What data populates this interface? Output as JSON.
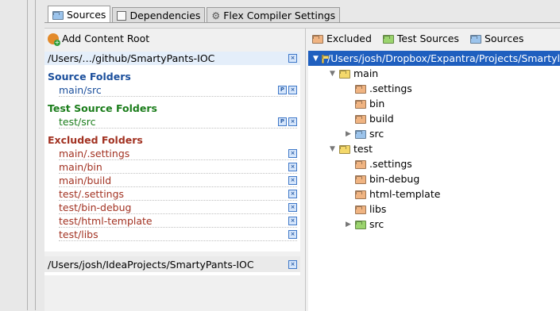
{
  "tabs": [
    {
      "label": "Sources",
      "icon": "sources-icon",
      "active": true
    },
    {
      "label": "Dependencies",
      "icon": "dependencies-icon",
      "active": false
    },
    {
      "label": "Flex Compiler Settings",
      "icon": "flex-compiler-icon",
      "active": false
    }
  ],
  "left": {
    "add_root": "Add Content Root",
    "root1": {
      "path": "/Users/…/github/SmartyPants-IOC",
      "source_title": "Source Folders",
      "source_folders": [
        "main/src"
      ],
      "test_title": "Test Source Folders",
      "test_folders": [
        "test/src"
      ],
      "excluded_title": "Excluded Folders",
      "excluded_folders": [
        "main/.settings",
        "main/bin",
        "main/build",
        "test/.settings",
        "test/bin-debug",
        "test/html-template",
        "test/libs"
      ]
    },
    "root2": {
      "path": "/Users/josh/IdeaProjects/SmartyPants-IOC"
    }
  },
  "right": {
    "mark_excluded": "Excluded",
    "mark_test": "Test Sources",
    "mark_sources": "Sources",
    "tree": [
      {
        "label": "/Users/josh/Dropbox/Expantra/Projects/Smartyl",
        "level": 0,
        "arrow": "▼",
        "color": "yellow",
        "selected": true
      },
      {
        "label": "main",
        "level": 1,
        "arrow": "▼",
        "color": "yellow"
      },
      {
        "label": ".settings",
        "level": 2,
        "arrow": "",
        "color": "orange"
      },
      {
        "label": "bin",
        "level": 2,
        "arrow": "",
        "color": "orange"
      },
      {
        "label": "build",
        "level": 2,
        "arrow": "",
        "color": "orange"
      },
      {
        "label": "src",
        "level": 2,
        "arrow": "▶",
        "color": "blue"
      },
      {
        "label": "test",
        "level": 1,
        "arrow": "▼",
        "color": "yellow"
      },
      {
        "label": ".settings",
        "level": 2,
        "arrow": "",
        "color": "orange"
      },
      {
        "label": "bin-debug",
        "level": 2,
        "arrow": "",
        "color": "orange"
      },
      {
        "label": "html-template",
        "level": 2,
        "arrow": "",
        "color": "orange"
      },
      {
        "label": "libs",
        "level": 2,
        "arrow": "",
        "color": "orange"
      },
      {
        "label": "src",
        "level": 2,
        "arrow": "▶",
        "color": "green"
      }
    ]
  },
  "colors": {
    "selection": "#1f5fbf",
    "source": "#1b4f9c",
    "test": "#1b7d1b",
    "excluded": "#a23222"
  }
}
